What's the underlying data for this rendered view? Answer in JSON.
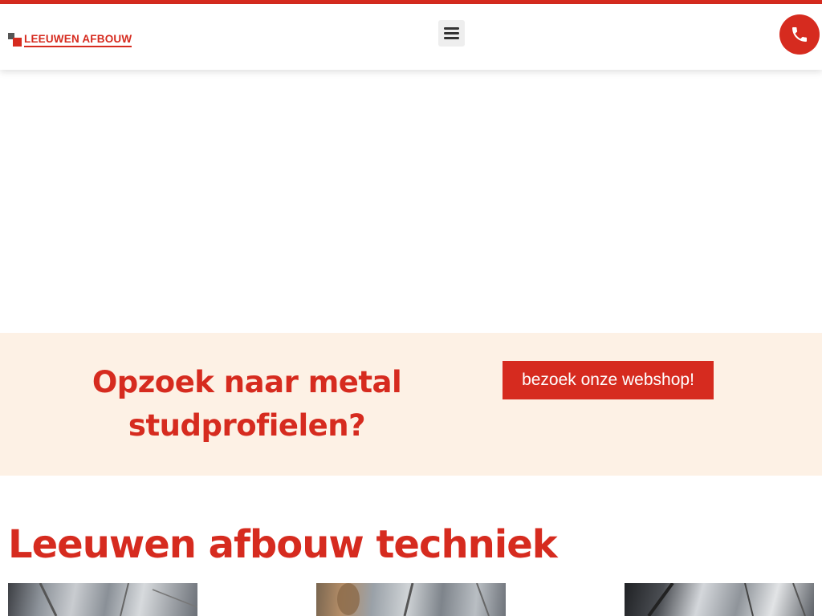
{
  "brand": {
    "name": "LEEUWEN AFBOUW",
    "accent": "#d62b1f"
  },
  "header": {
    "menu_icon": "hamburger-menu-icon",
    "phone_icon": "phone-icon"
  },
  "promo": {
    "heading": "Opzoek naar metal studprofielen?",
    "button_label": "bezoek onze webshop!",
    "background": "#fdf1e5"
  },
  "section": {
    "heading": "Leeuwen afbouw techniek"
  }
}
